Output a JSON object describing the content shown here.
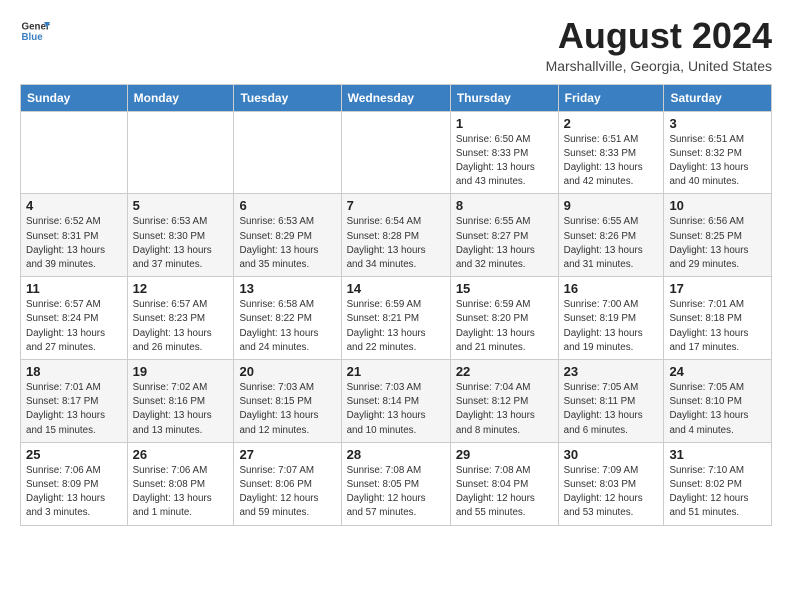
{
  "header": {
    "logo_line1": "General",
    "logo_line2": "Blue",
    "month_year": "August 2024",
    "location": "Marshallville, Georgia, United States"
  },
  "days_of_week": [
    "Sunday",
    "Monday",
    "Tuesday",
    "Wednesday",
    "Thursday",
    "Friday",
    "Saturday"
  ],
  "weeks": [
    [
      {
        "day": "",
        "info": ""
      },
      {
        "day": "",
        "info": ""
      },
      {
        "day": "",
        "info": ""
      },
      {
        "day": "",
        "info": ""
      },
      {
        "day": "1",
        "info": "Sunrise: 6:50 AM\nSunset: 8:33 PM\nDaylight: 13 hours\nand 43 minutes."
      },
      {
        "day": "2",
        "info": "Sunrise: 6:51 AM\nSunset: 8:33 PM\nDaylight: 13 hours\nand 42 minutes."
      },
      {
        "day": "3",
        "info": "Sunrise: 6:51 AM\nSunset: 8:32 PM\nDaylight: 13 hours\nand 40 minutes."
      }
    ],
    [
      {
        "day": "4",
        "info": "Sunrise: 6:52 AM\nSunset: 8:31 PM\nDaylight: 13 hours\nand 39 minutes."
      },
      {
        "day": "5",
        "info": "Sunrise: 6:53 AM\nSunset: 8:30 PM\nDaylight: 13 hours\nand 37 minutes."
      },
      {
        "day": "6",
        "info": "Sunrise: 6:53 AM\nSunset: 8:29 PM\nDaylight: 13 hours\nand 35 minutes."
      },
      {
        "day": "7",
        "info": "Sunrise: 6:54 AM\nSunset: 8:28 PM\nDaylight: 13 hours\nand 34 minutes."
      },
      {
        "day": "8",
        "info": "Sunrise: 6:55 AM\nSunset: 8:27 PM\nDaylight: 13 hours\nand 32 minutes."
      },
      {
        "day": "9",
        "info": "Sunrise: 6:55 AM\nSunset: 8:26 PM\nDaylight: 13 hours\nand 31 minutes."
      },
      {
        "day": "10",
        "info": "Sunrise: 6:56 AM\nSunset: 8:25 PM\nDaylight: 13 hours\nand 29 minutes."
      }
    ],
    [
      {
        "day": "11",
        "info": "Sunrise: 6:57 AM\nSunset: 8:24 PM\nDaylight: 13 hours\nand 27 minutes."
      },
      {
        "day": "12",
        "info": "Sunrise: 6:57 AM\nSunset: 8:23 PM\nDaylight: 13 hours\nand 26 minutes."
      },
      {
        "day": "13",
        "info": "Sunrise: 6:58 AM\nSunset: 8:22 PM\nDaylight: 13 hours\nand 24 minutes."
      },
      {
        "day": "14",
        "info": "Sunrise: 6:59 AM\nSunset: 8:21 PM\nDaylight: 13 hours\nand 22 minutes."
      },
      {
        "day": "15",
        "info": "Sunrise: 6:59 AM\nSunset: 8:20 PM\nDaylight: 13 hours\nand 21 minutes."
      },
      {
        "day": "16",
        "info": "Sunrise: 7:00 AM\nSunset: 8:19 PM\nDaylight: 13 hours\nand 19 minutes."
      },
      {
        "day": "17",
        "info": "Sunrise: 7:01 AM\nSunset: 8:18 PM\nDaylight: 13 hours\nand 17 minutes."
      }
    ],
    [
      {
        "day": "18",
        "info": "Sunrise: 7:01 AM\nSunset: 8:17 PM\nDaylight: 13 hours\nand 15 minutes."
      },
      {
        "day": "19",
        "info": "Sunrise: 7:02 AM\nSunset: 8:16 PM\nDaylight: 13 hours\nand 13 minutes."
      },
      {
        "day": "20",
        "info": "Sunrise: 7:03 AM\nSunset: 8:15 PM\nDaylight: 13 hours\nand 12 minutes."
      },
      {
        "day": "21",
        "info": "Sunrise: 7:03 AM\nSunset: 8:14 PM\nDaylight: 13 hours\nand 10 minutes."
      },
      {
        "day": "22",
        "info": "Sunrise: 7:04 AM\nSunset: 8:12 PM\nDaylight: 13 hours\nand 8 minutes."
      },
      {
        "day": "23",
        "info": "Sunrise: 7:05 AM\nSunset: 8:11 PM\nDaylight: 13 hours\nand 6 minutes."
      },
      {
        "day": "24",
        "info": "Sunrise: 7:05 AM\nSunset: 8:10 PM\nDaylight: 13 hours\nand 4 minutes."
      }
    ],
    [
      {
        "day": "25",
        "info": "Sunrise: 7:06 AM\nSunset: 8:09 PM\nDaylight: 13 hours\nand 3 minutes."
      },
      {
        "day": "26",
        "info": "Sunrise: 7:06 AM\nSunset: 8:08 PM\nDaylight: 13 hours\nand 1 minute."
      },
      {
        "day": "27",
        "info": "Sunrise: 7:07 AM\nSunset: 8:06 PM\nDaylight: 12 hours\nand 59 minutes."
      },
      {
        "day": "28",
        "info": "Sunrise: 7:08 AM\nSunset: 8:05 PM\nDaylight: 12 hours\nand 57 minutes."
      },
      {
        "day": "29",
        "info": "Sunrise: 7:08 AM\nSunset: 8:04 PM\nDaylight: 12 hours\nand 55 minutes."
      },
      {
        "day": "30",
        "info": "Sunrise: 7:09 AM\nSunset: 8:03 PM\nDaylight: 12 hours\nand 53 minutes."
      },
      {
        "day": "31",
        "info": "Sunrise: 7:10 AM\nSunset: 8:02 PM\nDaylight: 12 hours\nand 51 minutes."
      }
    ]
  ]
}
